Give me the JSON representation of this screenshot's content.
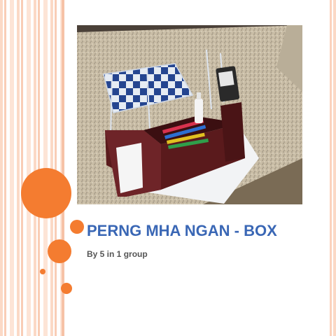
{
  "slide": {
    "title": "PERNG MHA NGAN - BOX",
    "subtitle": "By 5 in 1 group"
  },
  "colors": {
    "accent": "#f47c30",
    "title": "#3a67b5",
    "subtitle": "#555555",
    "strip": "#fbd9c6"
  },
  "photo": {
    "description_icon": "photo-of-desk-organizer-box"
  }
}
